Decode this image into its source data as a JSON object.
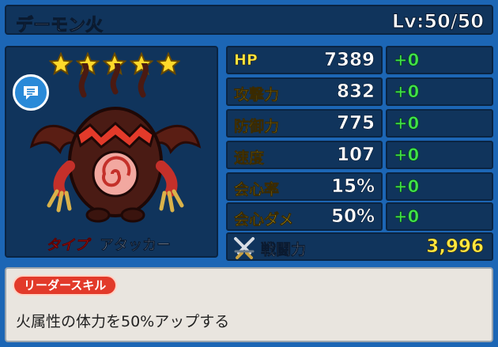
{
  "header": {
    "name": "デーモン火",
    "level": "Lv:50/50"
  },
  "portrait": {
    "star_count": 5,
    "chat_icon": "chat-bubble-icon",
    "type_label": "タイプ",
    "type_value": "アタッカー"
  },
  "stats": [
    {
      "label": "HP",
      "value": "7389",
      "bonus": "+0"
    },
    {
      "label": "攻撃力",
      "value": "832",
      "bonus": "+0"
    },
    {
      "label": "防御力",
      "value": "775",
      "bonus": "+0"
    },
    {
      "label": "速度",
      "value": "107",
      "bonus": "+0"
    },
    {
      "label": "会心率",
      "value": "15%",
      "bonus": "+0"
    },
    {
      "label": "会心ダメ",
      "value": "50%",
      "bonus": "+0"
    }
  ],
  "power": {
    "icon": "crossed-swords-icon",
    "label": "戦闘力",
    "value": "3,996"
  },
  "skill": {
    "badge": "リーダースキル",
    "description": "火属性の体力を50%アップする"
  },
  "colors": {
    "background": "#1c66b5",
    "panel": "#10345c",
    "stat_label": "#ffe640",
    "bonus": "#3fe04a",
    "type_label": "#e8302c",
    "skill_badge": "#e23a2a"
  }
}
